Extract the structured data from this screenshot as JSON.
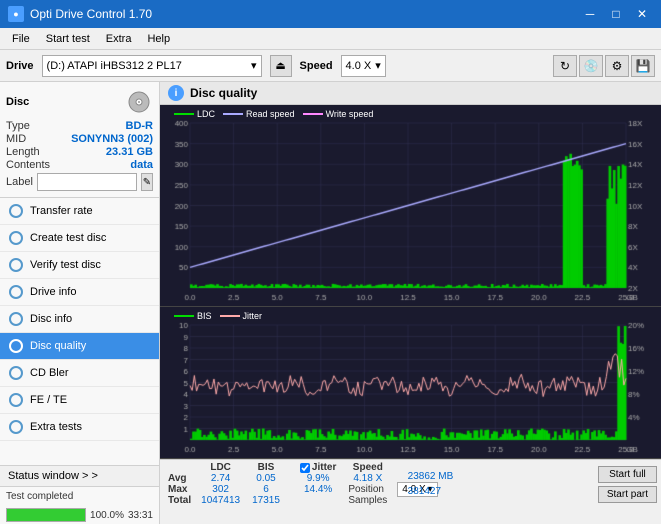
{
  "app": {
    "title": "Opti Drive Control 1.70",
    "icon": "●"
  },
  "title_controls": {
    "minimize": "─",
    "maximize": "□",
    "close": "✕"
  },
  "menu": {
    "items": [
      "File",
      "Start test",
      "Extra",
      "Help"
    ]
  },
  "drive_bar": {
    "label": "Drive",
    "drive_value": "(D:)  ATAPI iHBS312  2 PL17",
    "speed_label": "Speed",
    "speed_value": "4.0 X"
  },
  "disc": {
    "title": "Disc",
    "type_label": "Type",
    "type_value": "BD-R",
    "mid_label": "MID",
    "mid_value": "SONYNN3 (002)",
    "length_label": "Length",
    "length_value": "23.31 GB",
    "contents_label": "Contents",
    "contents_value": "data",
    "label_label": "Label"
  },
  "nav": {
    "items": [
      {
        "id": "transfer-rate",
        "label": "Transfer rate",
        "active": false
      },
      {
        "id": "create-test-disc",
        "label": "Create test disc",
        "active": false
      },
      {
        "id": "verify-test-disc",
        "label": "Verify test disc",
        "active": false
      },
      {
        "id": "drive-info",
        "label": "Drive info",
        "active": false
      },
      {
        "id": "disc-info",
        "label": "Disc info",
        "active": false
      },
      {
        "id": "disc-quality",
        "label": "Disc quality",
        "active": true
      },
      {
        "id": "cd-bler",
        "label": "CD Bler",
        "active": false
      },
      {
        "id": "fe-te",
        "label": "FE / TE",
        "active": false
      },
      {
        "id": "extra-tests",
        "label": "Extra tests",
        "active": false
      }
    ]
  },
  "disc_quality": {
    "title": "Disc quality",
    "legend_top": [
      {
        "label": "LDC",
        "color": "#00cc00"
      },
      {
        "label": "Read speed",
        "color": "#aaaaff"
      },
      {
        "label": "Write speed",
        "color": "#ff88ff"
      }
    ],
    "legend_bottom": [
      {
        "label": "BIS",
        "color": "#00cc00"
      },
      {
        "label": "Jitter",
        "color": "#ffaaaa"
      }
    ],
    "x_labels": [
      "0.0",
      "2.5",
      "5.0",
      "7.5",
      "10.0",
      "12.5",
      "15.0",
      "17.5",
      "20.0",
      "22.5",
      "25.0"
    ],
    "y_left_top": [
      "400",
      "350",
      "300",
      "250",
      "200",
      "150",
      "100",
      "50"
    ],
    "y_right_top": [
      "18X",
      "16X",
      "14X",
      "12X",
      "10X",
      "8X",
      "6X",
      "4X",
      "2X"
    ],
    "y_left_bottom": [
      "10",
      "9",
      "8",
      "7",
      "6",
      "5",
      "4",
      "3",
      "2",
      "1"
    ],
    "y_right_bottom": [
      "20%",
      "16%",
      "12%",
      "8%",
      "4%"
    ]
  },
  "stats": {
    "headers": [
      "LDC",
      "BIS",
      "",
      "Jitter",
      "Speed",
      ""
    ],
    "avg_label": "Avg",
    "avg_ldc": "2.74",
    "avg_bis": "0.05",
    "avg_jitter": "9.9%",
    "speed_val": "4.18 X",
    "speed_select": "4.0 X",
    "max_label": "Max",
    "max_ldc": "302",
    "max_bis": "6",
    "max_jitter": "14.4%",
    "position_label": "Position",
    "position_val": "23862 MB",
    "total_label": "Total",
    "total_ldc": "1047413",
    "total_bis": "17315",
    "samples_label": "Samples",
    "samples_val": "381427",
    "start_full_label": "Start full",
    "start_part_label": "Start part"
  },
  "status": {
    "window_label": "Status window > >",
    "progress": 100,
    "progress_text": "100.0%",
    "time_text": "33:31",
    "status_text": "Test completed"
  }
}
